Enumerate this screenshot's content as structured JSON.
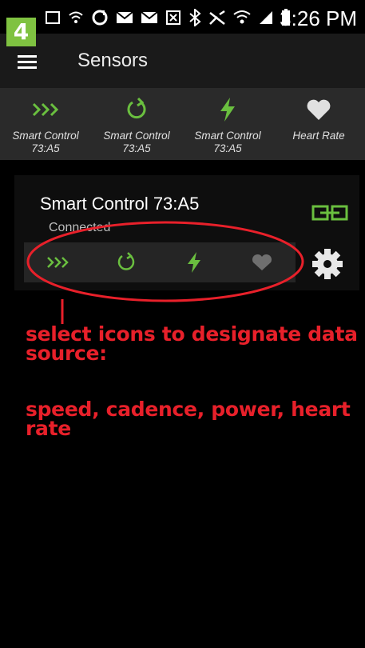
{
  "step_badge": "4",
  "status_bar": {
    "time": "3:26 PM",
    "icons": [
      "image-icon",
      "wifi-off-icon",
      "sync-icon",
      "mail-icon",
      "mail-icon",
      "nfc-icon",
      "bluetooth-icon",
      "mute-icon",
      "wifi-icon",
      "signal-icon",
      "battery-icon"
    ]
  },
  "app_bar": {
    "menu_icon": "hamburger-menu-icon",
    "title": "Sensors"
  },
  "source_bar": {
    "items": [
      {
        "icon": "speed-chevrons-icon",
        "label": "Smart Control\n73:A5",
        "color": "#6abf3f"
      },
      {
        "icon": "cadence-refresh-icon",
        "label": "Smart Control\n73:A5",
        "color": "#6abf3f"
      },
      {
        "icon": "power-bolt-icon",
        "label": "Smart Control\n73:A5",
        "color": "#6abf3f"
      },
      {
        "icon": "heart-icon",
        "label": "Heart Rate",
        "color": "#e0e0e0"
      }
    ]
  },
  "sensor_card": {
    "title": "Smart Control 73:A5",
    "status": "Connected",
    "link_icon": "paired-link-icon",
    "settings_icon": "gear-icon",
    "data_sources": [
      {
        "icon": "speed-chevrons-icon",
        "color": "#6abf3f"
      },
      {
        "icon": "cadence-refresh-icon",
        "color": "#6abf3f"
      },
      {
        "icon": "power-bolt-icon",
        "color": "#6abf3f"
      },
      {
        "icon": "heart-icon",
        "color": "#6f6f6f"
      }
    ]
  },
  "annotation": {
    "line1": "select icons to designate data source:",
    "line2": "speed, cadence, power, heart rate",
    "color": "#e8202a"
  },
  "colors": {
    "accent_green": "#6abf3f",
    "badge_green": "#7fc241",
    "app_bar_bg": "#1a1a1a",
    "source_bar_bg": "#2a2a2a"
  }
}
